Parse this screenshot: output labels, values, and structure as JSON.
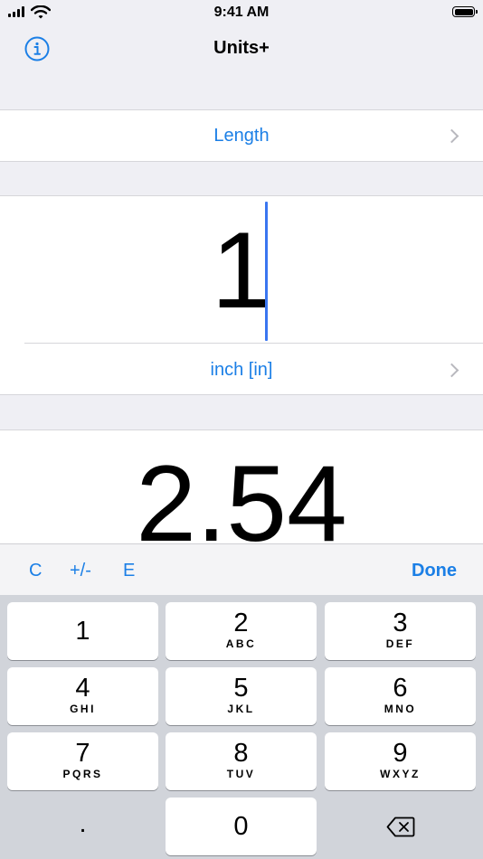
{
  "status_bar": {
    "time": "9:41 AM"
  },
  "nav": {
    "title": "Units+"
  },
  "category": {
    "label": "Length"
  },
  "input": {
    "value": "1",
    "unit": "inch [in]"
  },
  "result": {
    "value": "2.54"
  },
  "accessory": {
    "clear": "C",
    "sign": "+/-",
    "exponent": "E",
    "done": "Done"
  },
  "keypad": {
    "keys": [
      {
        "num": "1",
        "letters": ""
      },
      {
        "num": "2",
        "letters": "ABC"
      },
      {
        "num": "3",
        "letters": "DEF"
      },
      {
        "num": "4",
        "letters": "GHI"
      },
      {
        "num": "5",
        "letters": "JKL"
      },
      {
        "num": "6",
        "letters": "MNO"
      },
      {
        "num": "7",
        "letters": "PQRS"
      },
      {
        "num": "8",
        "letters": "TUV"
      },
      {
        "num": "9",
        "letters": "WXYZ"
      },
      {
        "num": "0",
        "letters": ""
      }
    ],
    "decimal": "."
  },
  "colors": {
    "accent": "#1b7fe6",
    "caret": "#3a76f0",
    "background": "#efeff4",
    "keypad": "#d1d4da"
  },
  "icons": {
    "info": "info-icon",
    "chevron": "chevron-right-icon",
    "backspace": "backspace-icon"
  }
}
